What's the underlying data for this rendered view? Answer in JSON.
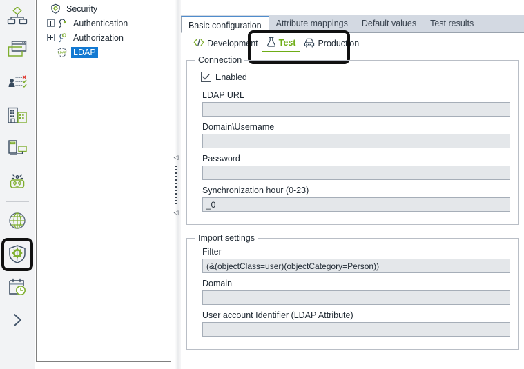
{
  "rail": {
    "items": [
      {
        "name": "organization-structure-icon",
        "label": "Organization structure"
      },
      {
        "name": "windows-icon",
        "label": "Windows"
      },
      {
        "name": "user-permissions-icon",
        "label": "User permissions"
      },
      {
        "name": "companies-icon",
        "label": "Companies"
      },
      {
        "name": "workstations-icon",
        "label": "Workstations"
      },
      {
        "name": "robot-icon",
        "label": "Robots"
      },
      {
        "name": "globe-icon",
        "label": "Web"
      },
      {
        "name": "security-shield-gear-icon",
        "label": "Security"
      },
      {
        "name": "schedule-calendar-clock-icon",
        "label": "Schedule"
      },
      {
        "name": "expand-chevron-icon",
        "label": "Expand"
      }
    ],
    "selected_index": 7
  },
  "tree": {
    "nodes": [
      {
        "label": "Security",
        "icon": "shield-gear-icon",
        "level": 0,
        "expander": "none",
        "selected": false
      },
      {
        "label": "Authentication",
        "icon": "authentication-key-icon",
        "level": 1,
        "expander": "plus",
        "selected": false
      },
      {
        "label": "Authorization",
        "icon": "authorization-key-icon",
        "level": 1,
        "expander": "plus",
        "selected": false
      },
      {
        "label": "LDAP",
        "icon": "ldap-shield-icon",
        "level": 1,
        "expander": "none",
        "selected": true
      }
    ]
  },
  "splitter": {
    "collapse_left_label": "◁",
    "collapse_right_label": "◁"
  },
  "tabs": {
    "items": [
      {
        "label": "Basic configuration",
        "active": true
      },
      {
        "label": "Attribute mappings",
        "active": false
      },
      {
        "label": "Default values",
        "active": false
      },
      {
        "label": "Test results",
        "active": false
      }
    ]
  },
  "subtabs": {
    "items": [
      {
        "label": "Development",
        "icon": "code-brackets-icon",
        "active": false
      },
      {
        "label": "Test",
        "icon": "flask-icon",
        "active": true
      },
      {
        "label": "Production",
        "icon": "server-rack-icon",
        "active": false
      }
    ]
  },
  "connection": {
    "legend": "Connection",
    "enabled": {
      "label": "Enabled",
      "checked": true
    },
    "fields": [
      {
        "label": "LDAP URL",
        "value": "",
        "placeholder": ""
      },
      {
        "label": "Domain\\Username",
        "value": "",
        "placeholder": ""
      },
      {
        "label": "Password",
        "value": "",
        "placeholder": ""
      },
      {
        "label": "Synchronization hour (0-23)",
        "value": "_0",
        "placeholder": ""
      }
    ]
  },
  "import_settings": {
    "legend": "Import settings",
    "fields": [
      {
        "label": "Filter",
        "value": "(&(objectClass=user)(objectCategory=Person))",
        "placeholder": ""
      },
      {
        "label": "Domain",
        "value": "",
        "placeholder": ""
      },
      {
        "label": "User account Identifier (LDAP Attribute)",
        "value": "",
        "placeholder": ""
      }
    ]
  },
  "colors": {
    "accent_green": "#6ead16",
    "selection_blue": "#1279d2",
    "tab_strip": "#d3d9e2",
    "field_bg": "#e4e7ea",
    "highlight_box": "#111111"
  }
}
